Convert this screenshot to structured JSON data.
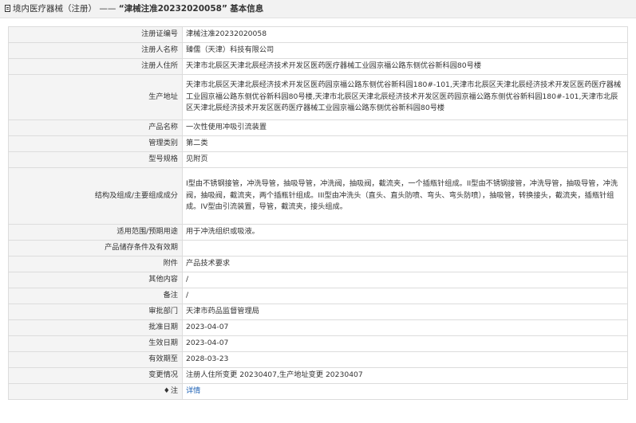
{
  "header": {
    "breadcrumb_prefix": "境内医疗器械（注册）",
    "separator": "——",
    "record_title": "“津械注准20232020058”",
    "suffix": "基本信息"
  },
  "rows": [
    {
      "label": "注册证编号",
      "value": "津械注准20232020058"
    },
    {
      "label": "注册人名称",
      "value": "臻儒（天津）科技有限公司"
    },
    {
      "label": "注册人住所",
      "value": "天津市北辰区天津北辰经济技术开发区医药医疗器械工业园京福公路东侧优谷新科园80号楼"
    },
    {
      "label": "生产地址",
      "value": "天津市北辰区天津北辰经济技术开发区医药园京福公路东侧优谷新科园180#-101,天津市北辰区天津北辰经济技术开发区医药医疗器械工业园京福公路东侧优谷新科园80号楼,天津市北辰区天津北辰经济技术开发区医药园京福公路东侧优谷新科园180#-101,天津市北辰区天津北辰经济技术开发区医药医疗器械工业园京福公路东侧优谷新科园80号楼"
    },
    {
      "label": "产品名称",
      "value": "一次性使用冲吸引流装置"
    },
    {
      "label": "管理类别",
      "value": "第二类"
    },
    {
      "label": "型号规格",
      "value": "见附页"
    },
    {
      "label": "结构及组成/主要组成成分",
      "value": "I型由不锈钢接管，冲洗导管，抽吸导管，冲洗阀，抽吸阀，截流夹，一个插瓶针组成。II型由不锈钢接管，冲洗导管，抽吸导管，冲洗阀，抽吸阀，截流夹，两个插瓶针组成。III型由冲洗头（直头、直头防喷、弯头、弯头防喷），抽吸管，转换接头，截流夹，插瓶针组成。IV型由引流装置，导管，截流夹，接头组成。"
    },
    {
      "label": "适用范围/预期用途",
      "value": "用于冲洗组织或吸液。"
    },
    {
      "label": "产品储存条件及有效期",
      "value": ""
    },
    {
      "label": "附件",
      "value": "产品技术要求"
    },
    {
      "label": "其他内容",
      "value": "/"
    },
    {
      "label": "备注",
      "value": "/"
    },
    {
      "label": "审批部门",
      "value": "天津市药品监督管理局"
    },
    {
      "label": "批准日期",
      "value": "2023-04-07"
    },
    {
      "label": "生效日期",
      "value": "2023-04-07"
    },
    {
      "label": "有效期至",
      "value": "2028-03-23"
    },
    {
      "label": "变更情况",
      "value": "注册人住所变更 20230407,生产地址变更 20230407"
    }
  ],
  "note_row": {
    "icon": "note-icon",
    "label": "注",
    "link_text": "详情"
  }
}
